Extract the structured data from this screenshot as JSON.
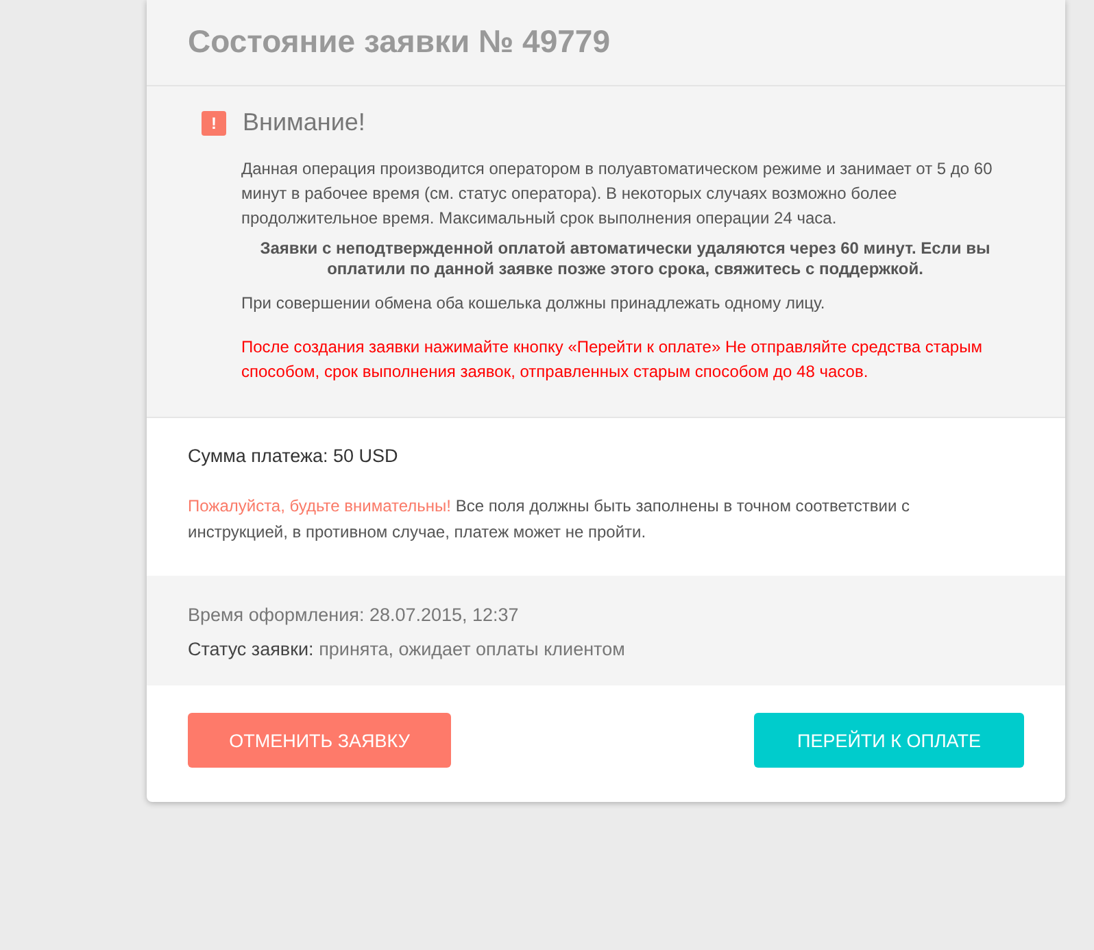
{
  "title": "Состояние заявки № 49779",
  "notice": {
    "icon": "!",
    "heading": "Внимание!",
    "paragraphs": [
      {
        "kind": "normal",
        "text": "Данная операция производится оператором в полуавтоматическом режиме и занимает от 5 до 60 минут в рабочее время (см. статус оператора). В некоторых случаях возможно более продолжительное время. Максимальный срок выполнения операции 24 часа."
      },
      {
        "kind": "bold",
        "text": "Заявки с неподтвержденной оплатой автоматически удаляются через 60 минут. Если вы оплатили по данной заявке позже этого срока, свяжитесь с поддержкой."
      },
      {
        "kind": "normal",
        "text": "При совершении обмена оба кошелька должны принадлежать одному лицу."
      },
      {
        "kind": "alert",
        "text": "После создания заявки нажимайте кнопку «Перейти к оплате» Не отправляйте средства старым способом, срок выполнения заявок, отправленных старым способом до 48 часов."
      }
    ]
  },
  "payment": {
    "amount": "Сумма платежа: 50 USD",
    "warning_lead": "Пожалуйста, будьте внимательны!",
    "warning_text": "Все поля должны быть заполнены в точном соответствии с инструкцией, в противном случае, платеж может не пройти."
  },
  "details": {
    "time": "Время оформления: 28.07.2015, 12:37",
    "status_label": "Статус заявки:",
    "status_value": "принята, ожидает оплаты клиентом"
  },
  "buttons": [
    {
      "kind": "cancel",
      "label": "ОТМЕНИТЬ ЗАЯВКУ"
    },
    {
      "kind": "pay",
      "label": "ПЕРЕЙТИ К ОПЛАТЕ"
    }
  ]
}
